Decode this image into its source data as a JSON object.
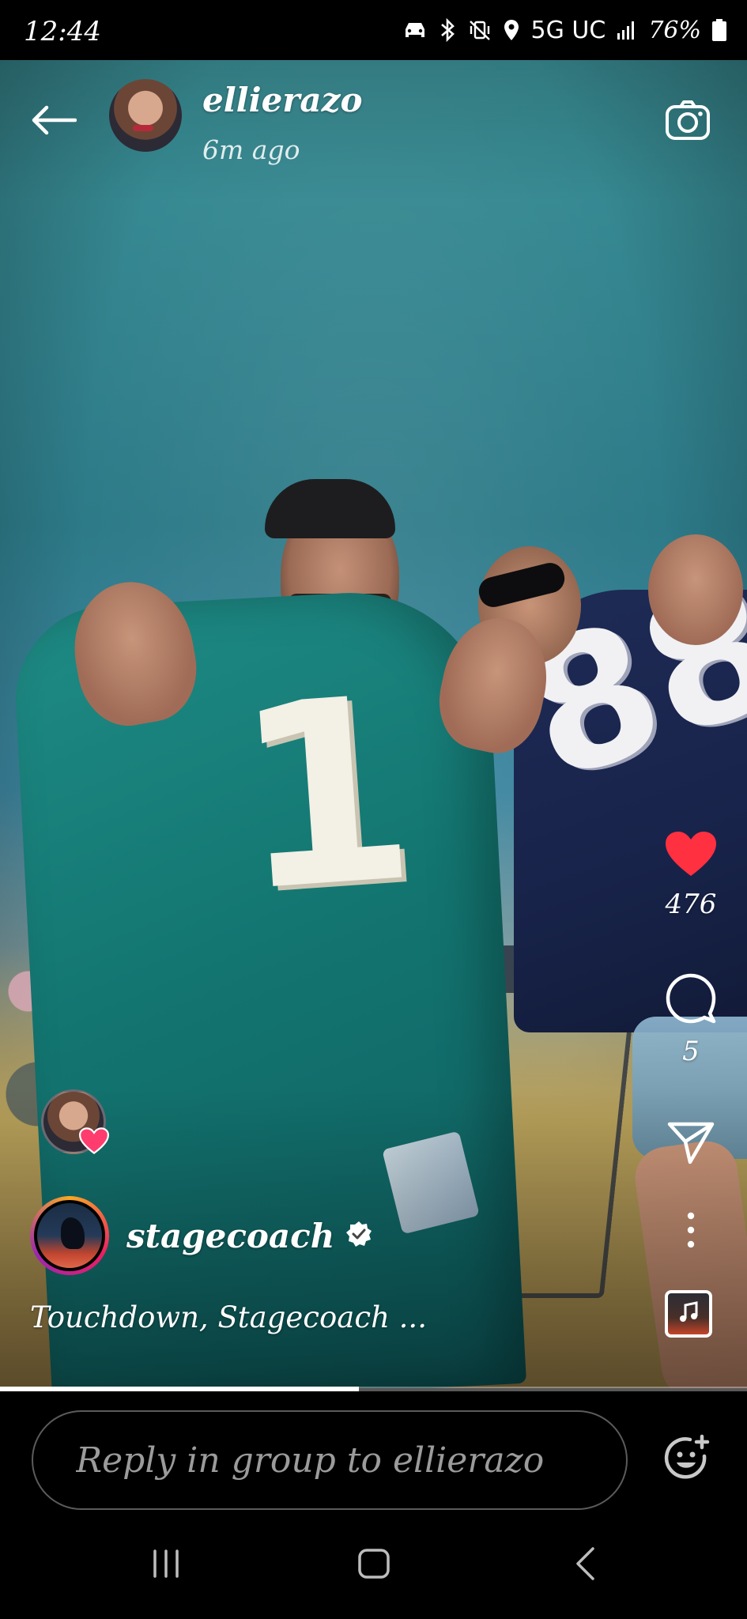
{
  "status_bar": {
    "time": "12:44",
    "network": "5G UC",
    "battery": "76%"
  },
  "story": {
    "username": "ellierazo",
    "posted": "6m ago",
    "progress": 0.48
  },
  "actions": {
    "like_count": "476",
    "comment_count": "5"
  },
  "music": {
    "artist": "stagecoach",
    "track": "Touchdown, Stagecoach ..."
  },
  "reply": {
    "placeholder": "Reply in group to ellierazo"
  },
  "icons": {
    "back": "back-arrow-icon",
    "camera": "camera-icon",
    "like": "heart-icon",
    "comment": "comment-icon",
    "share": "send-icon",
    "more": "more-vertical-icon",
    "music": "music-note-icon",
    "emoji": "emoji-add-icon"
  },
  "colors": {
    "like_active": "#ff3040",
    "accent_border": "#5b5b5b"
  }
}
